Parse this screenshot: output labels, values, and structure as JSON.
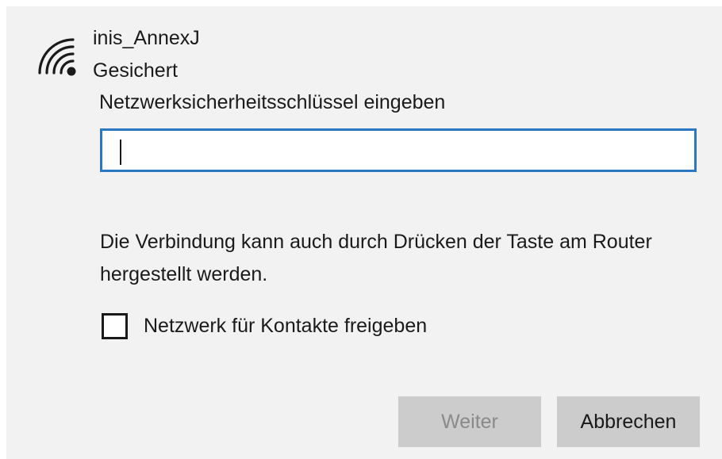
{
  "network": {
    "ssid": "inis_AnnexJ",
    "status": "Gesichert",
    "icon": "wifi-secured-icon"
  },
  "key_prompt": {
    "label": "Netzwerksicherheitsschlüssel eingeben",
    "value": ""
  },
  "hint": "Die Verbindung kann auch durch Drücken der Taste am Router hergestellt werden.",
  "share_checkbox": {
    "label": "Netzwerk für Kontakte freigeben",
    "checked": false
  },
  "buttons": {
    "next_label": "Weiter",
    "cancel_label": "Abbrechen"
  },
  "colors": {
    "background": "#f2f2f2",
    "input_border": "#2a78c2",
    "button": "#cccccc",
    "disabled_text": "#8a8a8a"
  }
}
